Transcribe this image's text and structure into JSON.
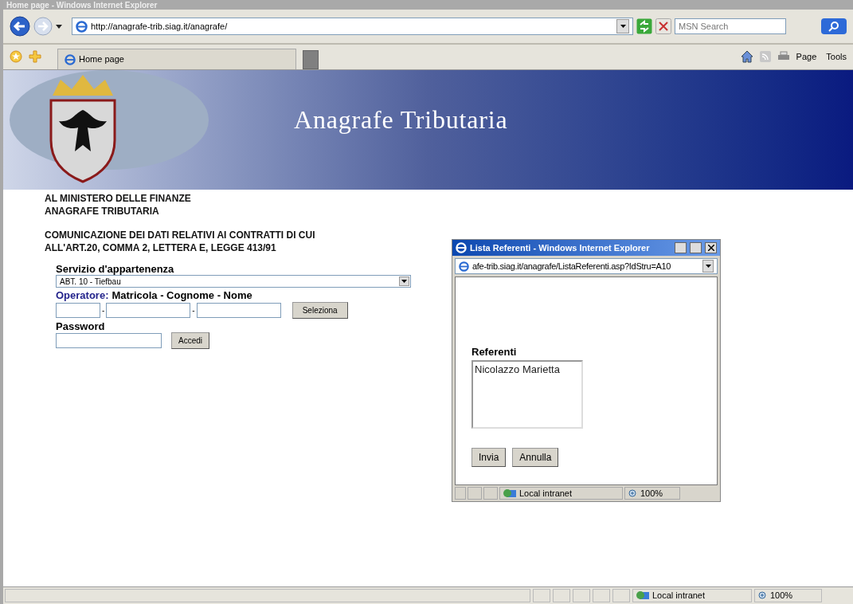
{
  "window": {
    "title": "Home page - Windows Internet Explorer"
  },
  "address_bar": {
    "url": "http://anagrafe-trib.siag.it/anagrafe/"
  },
  "search": {
    "placeholder": "MSN Search"
  },
  "tab": {
    "label": "Home page"
  },
  "command_bar": {
    "items": [
      "Page",
      "Tools"
    ]
  },
  "banner": {
    "title": "Anagrafe Tributaria"
  },
  "page": {
    "addressee": [
      "AL MINISTERO DELLE FINANZE",
      "ANAGRAFE TRIBUTARIA"
    ],
    "subject": [
      "COMUNICAZIONE DEI DATI RELATIVI AI CONTRATTI DI CUI",
      "ALL'ART.20, COMMA 2, LETTERA E, LEGGE 413/91"
    ],
    "service_label": "Servizio d'appartenenza",
    "service_value": "ABT. 10 - Tiefbau",
    "operator_prefix": "Operatore:",
    "operator_fields": "Matricola - Cognome - Nome",
    "separators": [
      "-",
      "-"
    ],
    "select_button": "Seleziona",
    "password_label": "Password",
    "login_button": "Accedi"
  },
  "popup": {
    "title": "Lista Referenti - Windows Internet Explorer",
    "url": "afe-trib.siag.it/anagrafe/ListaReferenti.asp?IdStru=A10",
    "list_label": "Referenti",
    "items": [
      {
        "label": "Nicolazzo Marietta",
        "selected": false
      }
    ],
    "buttons": [
      "Invia",
      "Annulla"
    ],
    "status": {
      "zone": "Local intranet",
      "zoom": "100%"
    }
  },
  "status_bar": {
    "zone": "Local intranet",
    "zoom": "100%"
  }
}
